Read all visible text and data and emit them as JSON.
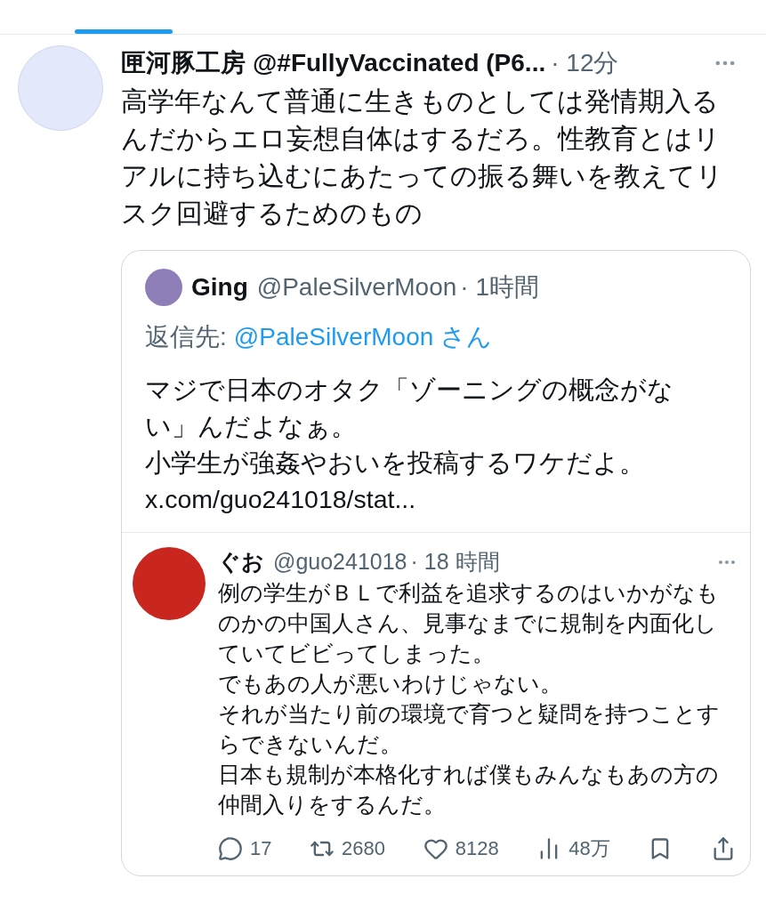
{
  "tab_indicator": {
    "selected": true
  },
  "post": {
    "name": "匣河豚工房",
    "handle": "@#FullyVaccinated (P6...",
    "time": "· 12分",
    "text": "高学年なんて普通に生きものとしては発情期入るんだからエロ妄想自体はするだろ。性教育とはリアルに持ち込むにあたっての振る舞いを教えてリスク回避するためのもの",
    "quote": {
      "name": "Ging",
      "handle": "@PaleSilverMoon",
      "time": "· 1時間",
      "reply_label": "返信先:",
      "reply_to": "@PaleSilverMoon さん",
      "lines": [
        "マジで日本のオタク「ゾーニングの概念がない」んだよなぁ。",
        "小学生が強姦やおいを投稿するワケだよ。",
        "x.com/guo241018/stat..."
      ],
      "embedded": {
        "name": "ぐお",
        "handle": "@guo241018",
        "time": "· 18 時間",
        "lines": [
          "例の学生がＢＬで利益を追求するのはいかがなものかの中国人さん、見事なまでに規制を内面化していてビビってしまった。",
          "でもあの人が悪いわけじゃない。",
          "それが当たり前の環境で育つと疑問を持つことすらできないんだ。",
          "日本も規制が本格化すれば僕もみんなもあの方の仲間入りをするんだ。"
        ],
        "actions": [
          {
            "kind": "reply",
            "count": "17"
          },
          {
            "kind": "repost",
            "count": "2680"
          },
          {
            "kind": "like",
            "count": "8128"
          },
          {
            "kind": "views",
            "count": "48万"
          },
          {
            "kind": "bookmark"
          },
          {
            "kind": "share"
          }
        ]
      }
    }
  }
}
